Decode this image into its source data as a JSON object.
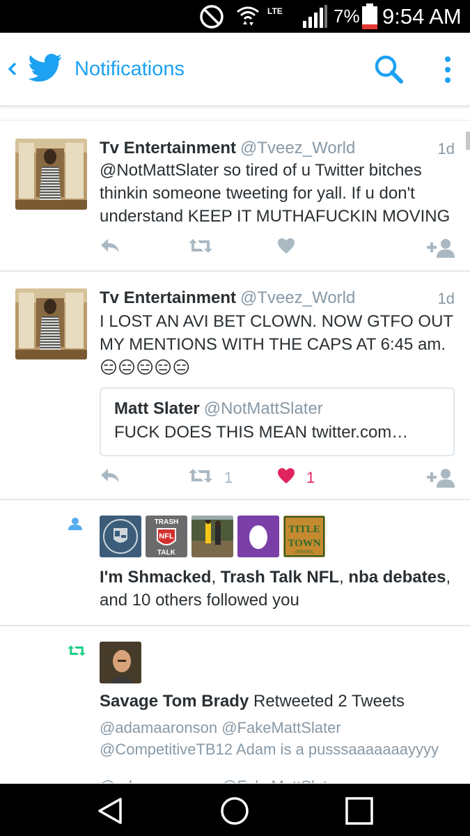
{
  "status_bar": {
    "network": "LTE",
    "battery_percent": "7%",
    "battery_level": 0.07,
    "time": "9:54 AM"
  },
  "app_bar": {
    "title": "Notifications",
    "icons": [
      "back-icon",
      "twitter-bird-icon",
      "search-icon",
      "more-vert-icon"
    ],
    "accent_color": "#1da1f2"
  },
  "tweets": [
    {
      "name": "Tv Entertainment",
      "handle": "@Tveez_World",
      "time": "1d",
      "text": "@NotMattSlater so tired of u Twitter bitches thinkin someone tweeting for yall. If u don't understand KEEP IT MUTHAFUCKIN MOVING",
      "retweets": "",
      "likes": "",
      "liked": false
    },
    {
      "name": "Tv Entertainment",
      "handle": "@Tveez_World",
      "time": "1d",
      "text": "I LOST AN AVI BET CLOWN. NOW GTFO OUT MY MENTIONS WITH THE CAPS AT 6:45 am.",
      "emoji": "😑😑😑😑😑",
      "quote": {
        "name": "Matt Slater",
        "handle": "@NotMattSlater",
        "text": "FUCK DOES THIS MEAN  twitter.com…"
      },
      "retweets": "1",
      "likes": "1",
      "liked": true
    }
  ],
  "follow_notification": {
    "icon": "person-icon",
    "names": [
      "I'm Shmacked",
      "Trash Talk NFL",
      "nba debates"
    ],
    "sep1": ", ",
    "sep2": ", ",
    "tail": ",",
    "line2": "and 10 others followed you",
    "avatar_labels": [
      "TRASH",
      "TALK",
      "TITLE",
      "TOWN",
      "APPAREL"
    ]
  },
  "retweet_notification": {
    "icon": "retweet-icon",
    "name": "Savage Tom Brady",
    "action": " Retweeted 2 Tweets",
    "line1": "@adamaaronson @FakeMattSlater",
    "line2": "@CompetitiveTB12 Adam is a pusssaaaaaaayyyy",
    "line3": "@adamaaronson @FakeMattSlater"
  },
  "nav_bar": {
    "icons": [
      "back-triangle-icon",
      "home-circle-icon",
      "recents-square-icon"
    ]
  }
}
